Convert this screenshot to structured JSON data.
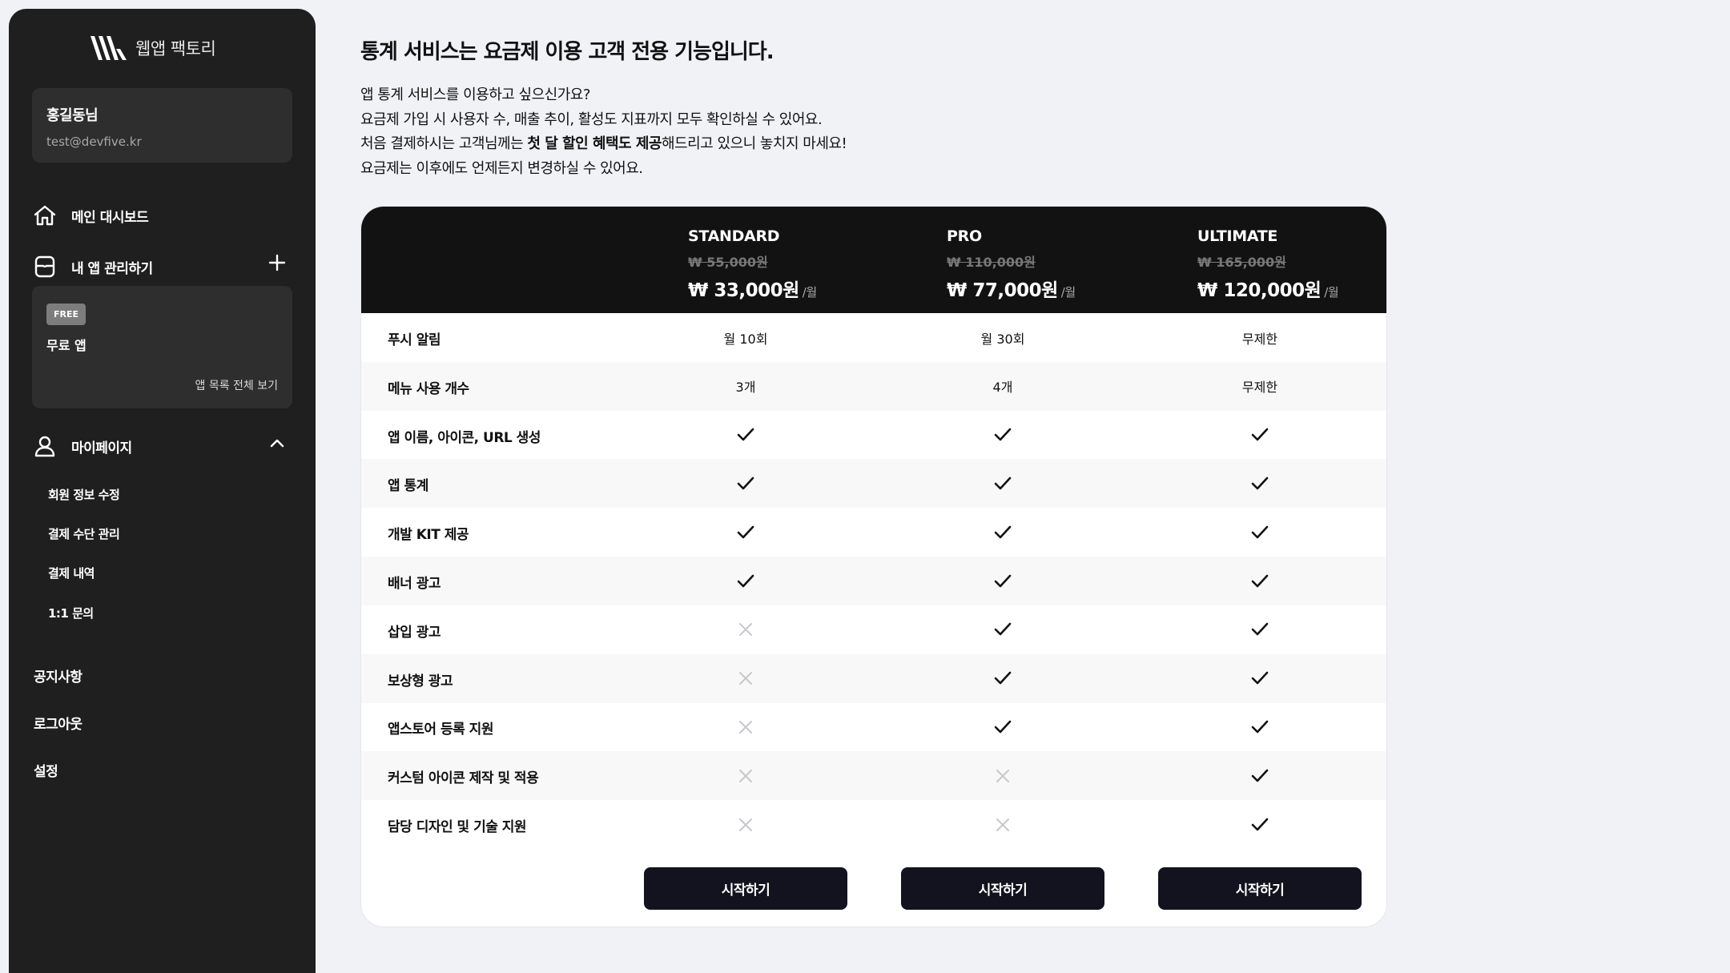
{
  "sidebar": {
    "logo_text": "웹앱 팩토리",
    "user": {
      "name": "홍길동님",
      "email": "test@devfive.kr"
    },
    "nav": {
      "dashboard": "메인 대시보드",
      "apps": "내 앱 관리하기",
      "mypage": "마이페이지"
    },
    "app_card": {
      "badge": "FREE",
      "name": "무료 앱",
      "view_all": "앱 목록 전체 보기"
    },
    "mypage_items": [
      "회원 정보 수정",
      "결제 수단 관리",
      "결제 내역",
      "1:1 문의"
    ],
    "bottom_items": [
      "공지사항",
      "로그아웃",
      "설정"
    ]
  },
  "main": {
    "title": "통계 서비스는 요금제 이용 고객 전용 기능입니다.",
    "intro": {
      "line1": "앱 통계 서비스를 이용하고 싶으신가요?",
      "line2": "요금제 가입 시 사용자 수, 매출 추이, 활성도 지표까지 모두 확인하실 수 있어요.",
      "line3_pre": "처음 결제하시는 고객님께는 ",
      "line3_bold": "첫 달 할인 혜택도 제공",
      "line3_post": "해드리고 있으니 놓치지 마세요!",
      "line4": "요금제는 이후에도 언제든지 변경하실 수 있어요."
    }
  },
  "plans": [
    {
      "name": "STANDARD",
      "old_price": "₩ 55,000원",
      "price": "₩ 33,000원",
      "per": "/월",
      "button": "시작하기"
    },
    {
      "name": "PRO",
      "old_price": "₩ 110,000원",
      "price": "₩ 77,000원",
      "per": "/월",
      "button": "시작하기"
    },
    {
      "name": "ULTIMATE",
      "old_price": "₩ 165,000원",
      "price": "₩ 120,000원",
      "per": "/월",
      "button": "시작하기"
    }
  ],
  "features": [
    {
      "label": "푸시 알림",
      "values": [
        "월 10회",
        "월 30회",
        "무제한"
      ]
    },
    {
      "label": "메뉴 사용 개수",
      "values": [
        "3개",
        "4개",
        "무제한"
      ]
    },
    {
      "label": "앱 이름, 아이콘, URL 생성",
      "values": [
        true,
        true,
        true
      ]
    },
    {
      "label": "앱 통계",
      "values": [
        true,
        true,
        true
      ]
    },
    {
      "label": "개발 KIT 제공",
      "values": [
        true,
        true,
        true
      ]
    },
    {
      "label": "배너 광고",
      "values": [
        true,
        true,
        true
      ]
    },
    {
      "label": "삽입 광고",
      "values": [
        false,
        true,
        true
      ]
    },
    {
      "label": "보상형 광고",
      "values": [
        false,
        true,
        true
      ]
    },
    {
      "label": "앱스토어 등록 지원",
      "values": [
        false,
        true,
        true
      ]
    },
    {
      "label": "커스텀 아이콘 제작 및 적용",
      "values": [
        false,
        false,
        true
      ]
    },
    {
      "label": "담당 디자인 및 기술 지원",
      "values": [
        false,
        false,
        true
      ]
    }
  ]
}
